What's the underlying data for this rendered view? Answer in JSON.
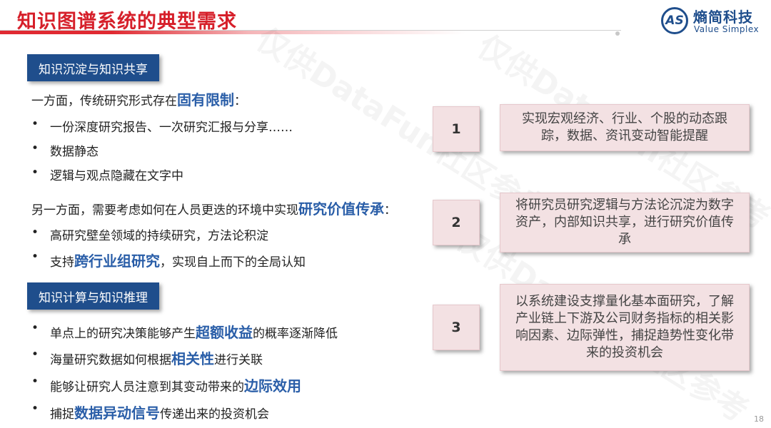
{
  "header": {
    "title": "知识图谱系统的典型需求",
    "logo_mark": "AS",
    "logo_cn": "熵简科技",
    "logo_en": "Value Simplex"
  },
  "watermarks": [
    "仅供DataFun社区参考",
    "仅供DataFun社区参考",
    "仅供DataFun社区参考"
  ],
  "section1": {
    "label": "知识沉淀与知识共享",
    "line1": {
      "pre": "一方面，传统研究形式存在",
      "hl": "固有限制",
      "post": "："
    },
    "bullets1": [
      {
        "pre": "一份深度研究报告、一次研究汇报与分享……",
        "hl": "",
        "post": ""
      },
      {
        "pre": "数据静态",
        "hl": "",
        "post": ""
      },
      {
        "pre": "逻辑与观点隐藏在文字中",
        "hl": "",
        "post": ""
      }
    ],
    "line2": {
      "pre": "另一方面，需要考虑如何在人员更迭的环境中实现",
      "hl": "研究价值传承",
      "post": "："
    },
    "bullets2": [
      {
        "pre": "高研究壁垒领域的持续研究，方法论积淀",
        "hl": "",
        "post": ""
      },
      {
        "pre": "支持",
        "hl": "跨行业组研究",
        "post": "，实现自上而下的全局认知"
      }
    ]
  },
  "section2": {
    "label": "知识计算与知识推理",
    "bullets": [
      {
        "pre": "单点上的研究决策能够产生",
        "hl": "超额收益",
        "post": "的概率逐渐降低"
      },
      {
        "pre": "海量研究数据如何根据",
        "hl": "相关性",
        "post": "进行关联"
      },
      {
        "pre": "能够让研究人员注意到其变动带来的",
        "hl": "边际效用",
        "post": ""
      },
      {
        "pre": "捕捉",
        "hl": "数据异动信号",
        "post": "传递出来的投资机会"
      }
    ]
  },
  "cards": [
    {
      "num": "1",
      "text": "实现宏观经济、行业、个股的动态跟踪，数据、资讯变动智能提醒"
    },
    {
      "num": "2",
      "text": "将研究员研究逻辑与方法论沉淀为数字资产，内部知识共享，进行研究价值传承"
    },
    {
      "num": "3",
      "text": "以系统建设支撑量化基本面研究，了解产业链上下游及公司财务指标的相关影响因素、边际弹性，捕捉趋势性变化带来的投资机会"
    }
  ],
  "page_number": "18",
  "colors": {
    "title_red": "#d61f2a",
    "brand_blue": "#1f4e8c",
    "highlight_blue": "#2a5ea8",
    "card_pink": "#f3e1e3"
  }
}
